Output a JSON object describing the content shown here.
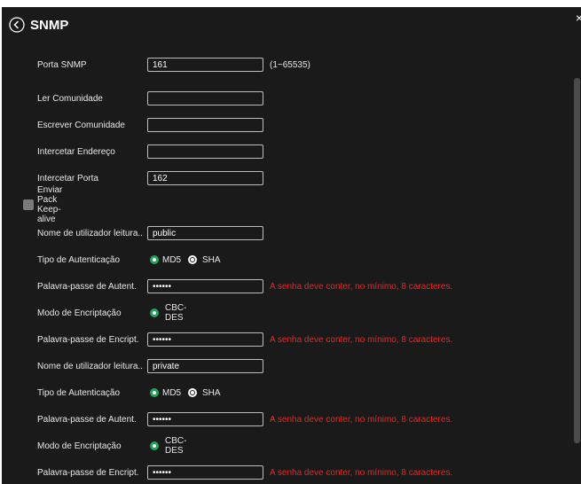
{
  "window": {
    "title": "SNMP",
    "close_glyph": "×"
  },
  "fields": {
    "porta_snmp": {
      "label": "Porta SNMP",
      "value": "161",
      "hint": "(1~65535)"
    },
    "ler_comunidade": {
      "label": "Ler Comunidade",
      "value": ""
    },
    "escrever_comunidade": {
      "label": "Escrever Comunidade",
      "value": ""
    },
    "intercetar_endereco": {
      "label": "Intercetar Endereço",
      "value": ""
    },
    "intercetar_porta": {
      "label": "Intercetar Porta",
      "value": "162"
    },
    "keepalive": {
      "label": "Enviar Pack Keep-alive",
      "checked": false
    }
  },
  "user_read": {
    "username_label": "Nome de utilizador leitura...",
    "username_value": "public",
    "auth_type_label": "Tipo de Autenticação",
    "auth_options": [
      "MD5",
      "SHA"
    ],
    "auth_selected": "MD5",
    "auth_pass_label": "Palavra-passe de Autent.",
    "auth_pass_value": "••••••",
    "auth_pass_error": "A senha deve conter, no mínimo, 8 caracteres.",
    "enc_mode_label": "Modo de Encriptação",
    "enc_option": "CBC-DES",
    "enc_pass_label": "Palavra-passe de Encript.",
    "enc_pass_value": "••••••",
    "enc_pass_error": "A senha deve conter, no mínimo, 8 caracteres."
  },
  "user_write": {
    "username_label": "Nome de utilizador leitura...",
    "username_value": "private",
    "auth_type_label": "Tipo de Autenticação",
    "auth_options": [
      "MD5",
      "SHA"
    ],
    "auth_selected": "MD5",
    "auth_pass_label": "Palavra-passe de Autent.",
    "auth_pass_value": "••••••",
    "auth_pass_error": "A senha deve conter, no mínimo, 8 caracteres.",
    "enc_mode_label": "Modo de Encriptação",
    "enc_option": "CBC-DES",
    "enc_pass_label": "Palavra-passe de Encript.",
    "enc_pass_value": "••••••",
    "enc_pass_error": "A senha deve conter, no mínimo, 8 caracteres."
  },
  "colors": {
    "background": "#1a1a1a",
    "accent": "#22a35a",
    "error": "#e52626"
  },
  "icons": {
    "back": "back-circle-icon",
    "close": "close-icon"
  }
}
